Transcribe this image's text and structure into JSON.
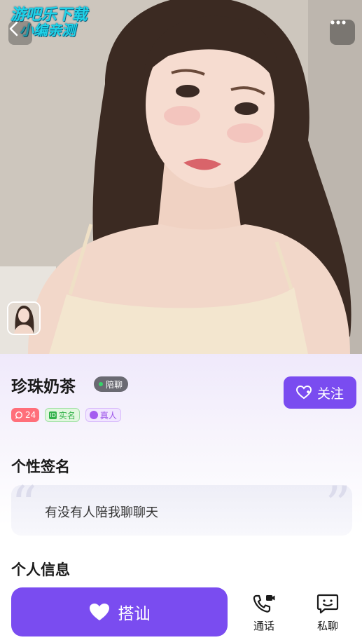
{
  "watermark": {
    "line1": "游吧乐下载",
    "line2": "小编亲测"
  },
  "hero": {
    "back_icon": "chevron-left-icon",
    "more_icon": "more-dots-icon"
  },
  "profile": {
    "name": "珍珠奶茶",
    "status_badge": "陪聊",
    "status_color": "#37d46a",
    "follow_label": "关注",
    "tags": {
      "count": "24",
      "real_name": "实名",
      "real_person": "真人"
    }
  },
  "signature": {
    "title": "个性签名",
    "text": "有没有人陪我聊聊天"
  },
  "info": {
    "title": "个人信息"
  },
  "bottom": {
    "chat_label": "搭讪",
    "call_label": "通话",
    "message_label": "私聊"
  },
  "colors": {
    "accent": "#7a4cf0",
    "count_tag": "#ff6f7a",
    "real_name_tag": "#33b24a",
    "real_person_tag": "#9a50e8"
  }
}
